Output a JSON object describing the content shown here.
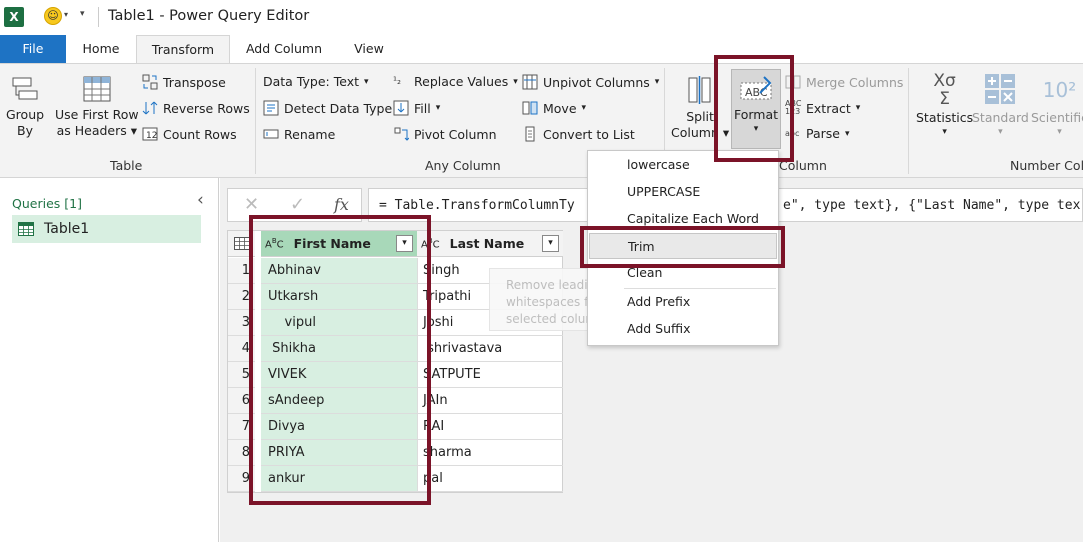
{
  "window": {
    "title": "Table1 - Power Query Editor"
  },
  "tabs": [
    {
      "label": "File"
    },
    {
      "label": "Home"
    },
    {
      "label": "Transform"
    },
    {
      "label": "Add Column"
    },
    {
      "label": "View"
    }
  ],
  "ribbon": {
    "table": {
      "group_label": "Table",
      "group_by": "Group\nBy",
      "use_first_row": "Use First Row\nas Headers",
      "transpose": "Transpose",
      "reverse_rows": "Reverse Rows",
      "count_rows": "Count Rows"
    },
    "any_column": {
      "group_label": "Any Column",
      "data_type": "Data Type: Text",
      "detect_data_type": "Detect Data Type",
      "rename": "Rename",
      "replace_values": "Replace Values",
      "fill": "Fill",
      "pivot_column": "Pivot Column",
      "unpivot_columns": "Unpivot Columns",
      "move": "Move",
      "convert_to_list": "Convert to List"
    },
    "text_column": {
      "group_label": "Column",
      "split_column": "Split\nColumn",
      "format": "Format",
      "merge_columns": "Merge Columns",
      "extract": "Extract",
      "parse": "Parse"
    },
    "number_column": {
      "group_label": "Number Colu",
      "statistics": "Statistics",
      "standard": "Standard",
      "scientific": "Scientific"
    }
  },
  "queries": {
    "header": "Queries [1]",
    "items": [
      {
        "label": "Table1"
      }
    ]
  },
  "formula_bar": {
    "formula": "= Table.TransformColumnTy",
    "formula_tail": "e\", type text}, {\"Last Name\", type tex"
  },
  "table": {
    "columns": [
      "First Name",
      "Last Name"
    ],
    "rows": [
      {
        "n": "1",
        "first": "Abhinav",
        "last": "Singh"
      },
      {
        "n": "2",
        "first": "Utkarsh",
        "last": "Tripathi"
      },
      {
        "n": "3",
        "first": "    vipul",
        "last": "Joshi"
      },
      {
        "n": "4",
        "first": " Shikha",
        "last": " shrivastava"
      },
      {
        "n": "5",
        "first": "VIVEK",
        "last": "SATPUTE"
      },
      {
        "n": "6",
        "first": "sAndeep",
        "last": "JAIn"
      },
      {
        "n": "7",
        "first": "Divya",
        "last": "RAI"
      },
      {
        "n": "8",
        "first": "PRIYA",
        "last": "sharma"
      },
      {
        "n": "9",
        "first": "ankur",
        "last": "pal"
      }
    ]
  },
  "format_menu": {
    "items": [
      {
        "label": "lowercase"
      },
      {
        "label": "UPPERCASE"
      },
      {
        "label": "Capitalize Each Word"
      },
      {
        "label": "Trim"
      },
      {
        "label": "Clean"
      },
      {
        "label": "Add Prefix"
      },
      {
        "label": "Add Suffix"
      }
    ],
    "tooltip": "Remove leading and trailing whitespaces from each of the selected columns."
  },
  "colors": {
    "accent": "#217346",
    "file_tab": "#1e73c4",
    "highlight": "#7b1328",
    "selected_column": "#d8efe1"
  }
}
